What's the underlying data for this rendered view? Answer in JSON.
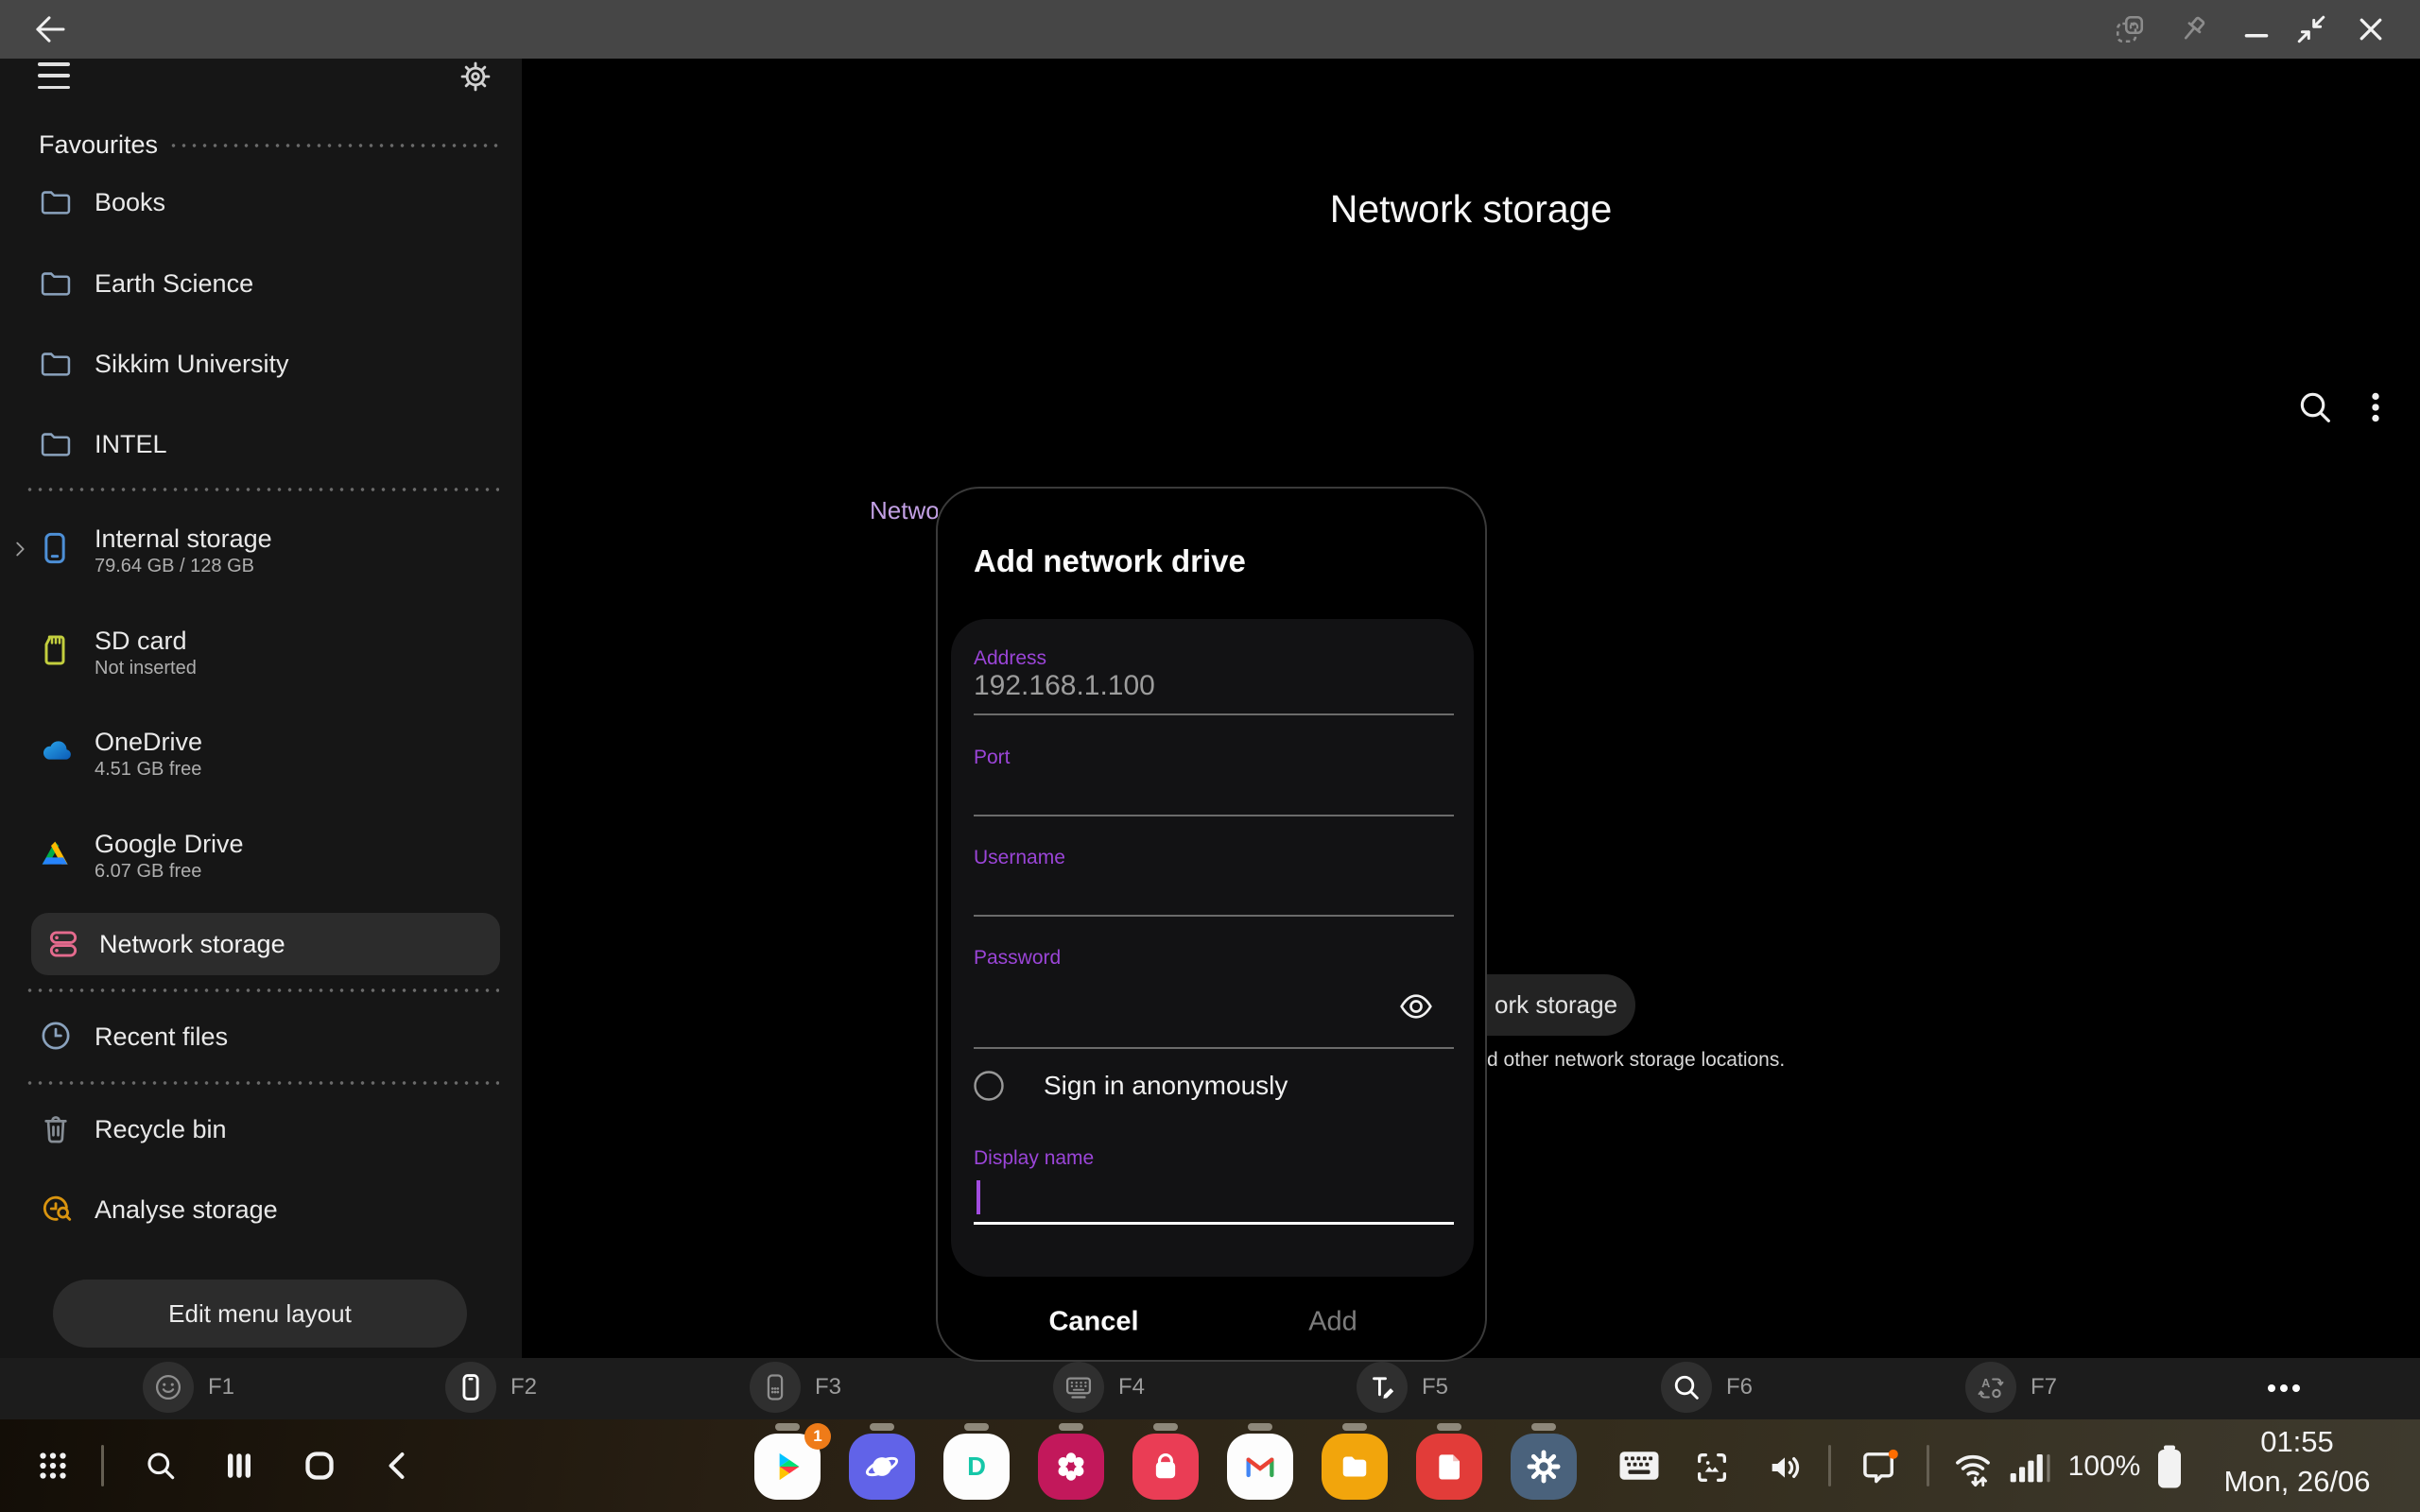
{
  "sidebar": {
    "favourites_header": "Favourites",
    "favourites": [
      {
        "label": "Books",
        "icon": "folder-icon"
      },
      {
        "label": "Earth Science",
        "icon": "folder-icon"
      },
      {
        "label": "Sikkim University",
        "icon": "folder-icon"
      },
      {
        "label": "INTEL",
        "icon": "folder-icon"
      }
    ],
    "storage": [
      {
        "label": "Internal storage",
        "detail": "79.64 GB / 128 GB",
        "icon": "phone-icon"
      },
      {
        "label": "SD card",
        "detail": "Not inserted",
        "icon": "sd-card-icon"
      },
      {
        "label": "OneDrive",
        "detail": "4.51 GB free",
        "icon": "onedrive-cloud-icon"
      },
      {
        "label": "Google Drive",
        "detail": "6.07 GB free",
        "icon": "google-drive-icon"
      }
    ],
    "items": [
      {
        "label": "Network storage",
        "icon": "network-drive-icon",
        "selected": true
      },
      {
        "label": "Recent files",
        "icon": "clock-icon",
        "selected": false
      },
      {
        "label": "Recycle bin",
        "icon": "trash-icon",
        "selected": false
      },
      {
        "label": "Analyse storage",
        "icon": "analyse-storage-icon",
        "selected": false
      }
    ],
    "edit_menu_button": "Edit menu layout"
  },
  "main": {
    "title": "Network storage",
    "background_fragments": {
      "link_text": "Networ",
      "button_text": "ork storage",
      "caption_text": "d other network storage locations."
    }
  },
  "dialog": {
    "title": "Add network drive",
    "fields": {
      "address": {
        "label": "Address",
        "value": "192.168.1.100"
      },
      "port": {
        "label": "Port",
        "value": ""
      },
      "username": {
        "label": "Username",
        "value": ""
      },
      "password": {
        "label": "Password",
        "value": ""
      },
      "display_name": {
        "label": "Display name",
        "value": ""
      }
    },
    "anonymous_option": "Sign in anonymously",
    "buttons": {
      "cancel": "Cancel",
      "add": "Add"
    }
  },
  "function_bar": {
    "keys": [
      {
        "label": "F1",
        "icon": "smiley-icon"
      },
      {
        "label": "F2",
        "icon": "phone-outline-icon"
      },
      {
        "label": "F3",
        "icon": "dialer-icon"
      },
      {
        "label": "F4",
        "icon": "keyboard-icon"
      },
      {
        "label": "F5",
        "icon": "text-edit-icon"
      },
      {
        "label": "F6",
        "icon": "search-icon"
      },
      {
        "label": "F7",
        "icon": "translate-icon"
      }
    ]
  },
  "taskbar": {
    "play_store_badge": "1",
    "battery_percent": "100%",
    "clock_time": "01:55",
    "clock_date": "Mon, 26/06"
  },
  "colors": {
    "field_label_purple": "#9b45d8",
    "selected_row_bg": "#2c2c2c",
    "network_icon_pink": "#e56b8e",
    "analyse_icon_amber": "#d9940f",
    "badge_orange": "#ef7b18",
    "titlebar_gray": "#464646"
  }
}
